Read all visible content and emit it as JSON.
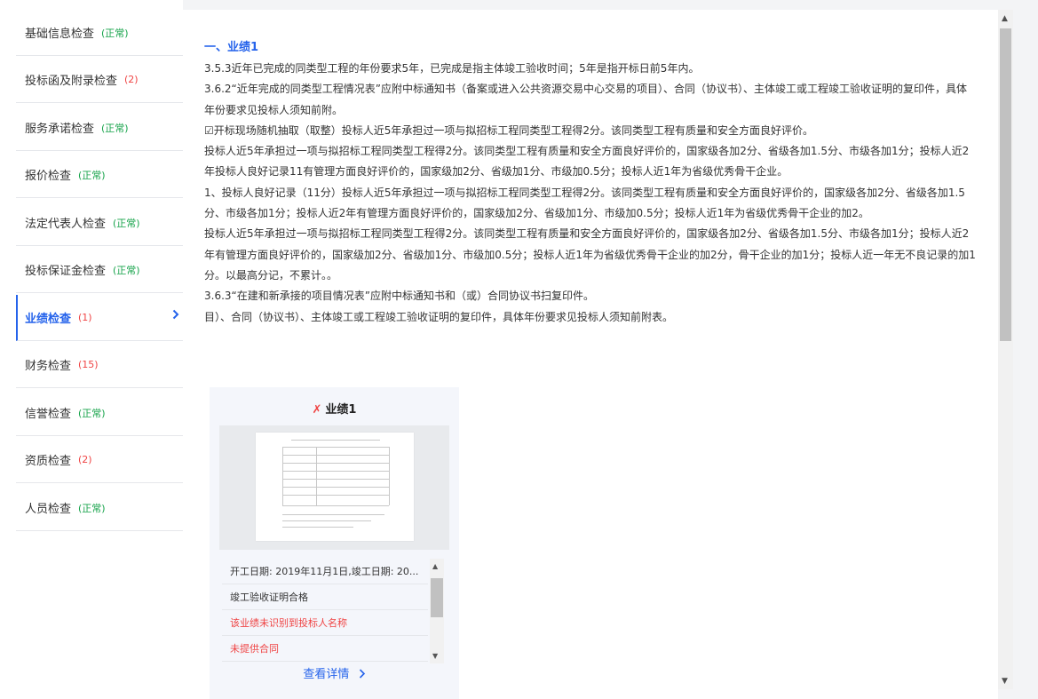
{
  "sidebar": {
    "items": [
      {
        "label": "基础信息检查",
        "badge": "(正常)",
        "status": "ok"
      },
      {
        "label": "投标函及附录检查",
        "badge": "(2)",
        "status": "err"
      },
      {
        "label": "服务承诺检查",
        "badge": "(正常)",
        "status": "ok"
      },
      {
        "label": "报价检查",
        "badge": "(正常)",
        "status": "ok"
      },
      {
        "label": "法定代表人检查",
        "badge": "(正常)",
        "status": "ok"
      },
      {
        "label": "投标保证金检查",
        "badge": "(正常)",
        "status": "ok"
      },
      {
        "label": "业绩检查",
        "badge": "(1)",
        "status": "err",
        "active": true
      },
      {
        "label": "财务检查",
        "badge": "(15)",
        "status": "err"
      },
      {
        "label": "信誉检查",
        "badge": "(正常)",
        "status": "ok"
      },
      {
        "label": "资质检查",
        "badge": "(2)",
        "status": "err"
      },
      {
        "label": "人员检查",
        "badge": "(正常)",
        "status": "ok"
      }
    ]
  },
  "main": {
    "section_title": "一、业绩1",
    "paragraphs": [
      "3.5.3近年已完成的同类型工程的年份要求5年，已完成是指主体竣工验收时间；5年是指开标日前5年内。",
      "3.6.2“近年完成的同类型工程情况表”应附中标通知书（备案或进入公共资源交易中心交易的项目）、合同（协议书）、主体竣工或工程竣工验收证明的复印件，具体年份要求见投标人须知前附。",
      "☑开标现场随机抽取（取整）投标人近5年承担过一项与拟招标工程同类型工程得2分。该同类型工程有质量和安全方面良好评价。",
      "投标人近5年承担过一项与拟招标工程同类型工程得2分。该同类型工程有质量和安全方面良好评价的，国家级各加2分、省级各加1.5分、市级各加1分；投标人近2年投标人良好记录11有管理方面良好评价的，国家级加2分、省级加1分、市级加0.5分；投标人近1年为省级优秀骨干企业。",
      "1、投标人良好记录（11分）投标人近5年承担过一项与拟招标工程同类型工程得2分。该同类型工程有质量和安全方面良好评价的，国家级各加2分、省级各加1.5分、市级各加1分；投标人近2年有管理方面良好评价的，国家级加2分、省级加1分、市级加0.5分；投标人近1年为省级优秀骨干企业的加2。",
      "投标人近5年承担过一项与拟招标工程同类型工程得2分。该同类型工程有质量和安全方面良好评价的，国家级各加2分、省级各加1.5分、市级各加1分；投标人近2年有管理方面良好评价的，国家级加2分、省级加1分、市级加0.5分；投标人近1年为省级优秀骨干企业的加2分，骨干企业的加1分；投标人近一年无不良记录的加1分。以最高分记，不累计。。",
      "3.6.3“在建和新承接的项目情况表”应附中标通知书和（或）合同协议书扫复印件。",
      "目）、合同（协议书）、主体竣工或工程竣工验收证明的复印件，具体年份要求见投标人须知前附表。"
    ],
    "card": {
      "status_mark": "✗",
      "title": "业绩1",
      "rows": [
        {
          "text": "开工日期: 2019年11月1日,竣工日期: 20...",
          "tone": "normal"
        },
        {
          "text": "竣工验收证明合格",
          "tone": "normal"
        },
        {
          "text": "该业绩未识别到投标人名称",
          "tone": "red"
        },
        {
          "text": "未提供合同",
          "tone": "red"
        }
      ],
      "link_label": "查看详情",
      "link_icon": "chevron-right-icon"
    }
  },
  "colors": {
    "accent": "#2563eb",
    "ok": "#16a34a",
    "error": "#ef4444"
  }
}
